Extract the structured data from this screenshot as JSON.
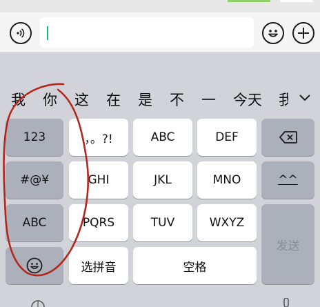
{
  "candidates": [
    "我",
    "你",
    "这",
    "在",
    "是",
    "不",
    "一",
    "今天",
    "我"
  ],
  "keyboard": {
    "k_123": "123",
    "k_punct": "，。?!",
    "k_abc": "ABC",
    "k_def": "DEF",
    "k_symbols": "#@¥",
    "k_ghi": "GHI",
    "k_jkl": "JKL",
    "k_mno": "MNO",
    "k_emoticon": "^^",
    "k_abc_mode": "ABC",
    "k_pqrs": "PQRS",
    "k_tuv": "TUV",
    "k_wxyz": "WXYZ",
    "k_pinyin": "选拼音",
    "k_space": "空格",
    "k_send": "发送"
  },
  "icons": {
    "voice": "voice-icon",
    "emoji": "smiley-icon",
    "plus": "plus-icon",
    "backspace": "backspace-icon",
    "expand": "chevron-down-icon",
    "keyboard_emoji": "smiley-icon"
  },
  "colors": {
    "cursor": "#07c160",
    "annotation": "#b3261e"
  }
}
